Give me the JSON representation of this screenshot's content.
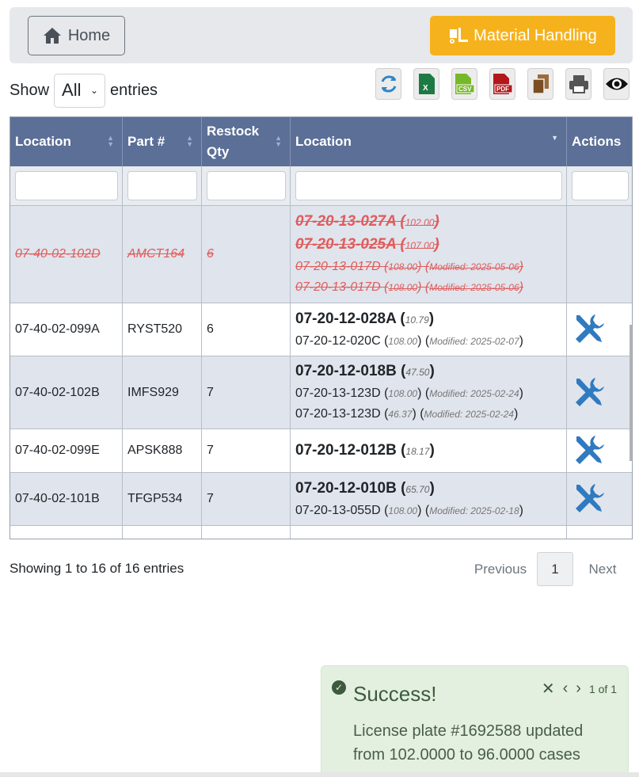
{
  "header": {
    "home_label": "Home",
    "material_label": "Material Handling",
    "accent_color": "#f6b21c"
  },
  "length_menu": {
    "show_label": "Show",
    "selected": "All",
    "entries_label": "entries"
  },
  "toolbar": {
    "buttons": [
      "refresh-icon",
      "excel-icon",
      "csv-icon",
      "pdf-icon",
      "copy-icon",
      "print-icon",
      "eye-icon"
    ],
    "excel_text": "X",
    "csv_text": "CSV",
    "pdf_text": "PDF"
  },
  "table": {
    "columns": [
      "Location",
      "Part #",
      "Restock Qty",
      "Location",
      "Actions"
    ],
    "rows": [
      {
        "location": "07-40-02-102D",
        "part": "AMCT164",
        "restock": "6",
        "main_locs": [
          {
            "loc": "07-20-13-027A",
            "qty": "102.00"
          },
          {
            "loc": "07-20-13-025A",
            "qty": "107.00"
          }
        ],
        "sub_locs": [
          {
            "loc": "07-20-13-017D",
            "qty": "108.00",
            "mod": "Modified: 2025-05-06"
          },
          {
            "loc": "07-20-13-017D",
            "qty": "108.00",
            "mod": "Modified: 2025-05-06"
          }
        ]
      },
      {
        "location": "07-40-02-099A",
        "part": "RYST520",
        "restock": "6",
        "main_loc": "07-20-12-028A",
        "main_qty": "10.79",
        "sub_locs": [
          {
            "loc": "07-20-12-020C",
            "qty": "108.00",
            "mod": "Modified: 2025-02-07"
          }
        ]
      },
      {
        "location": "07-40-02-102B",
        "part": "IMFS929",
        "restock": "7",
        "main_loc": "07-20-12-018B",
        "main_qty": "47.50",
        "sub_locs": [
          {
            "loc": "07-20-13-123D",
            "qty": "108.00",
            "mod": "Modified: 2025-02-24"
          },
          {
            "loc": "07-20-13-123D",
            "qty": "46.37",
            "mod": "Modified: 2025-02-24"
          }
        ]
      },
      {
        "location": "07-40-02-099E",
        "part": "APSK888",
        "restock": "7",
        "main_loc": "07-20-12-012B",
        "main_qty": "18.17",
        "sub_locs": []
      },
      {
        "location": "07-40-02-101B",
        "part": "TFGP534",
        "restock": "7",
        "main_loc": "07-20-12-010B",
        "main_qty": "65.70",
        "sub_locs": [
          {
            "loc": "07-20-13-055D",
            "qty": "108.00",
            "mod": "Modified: 2025-02-18"
          }
        ]
      }
    ]
  },
  "info_text": "Showing 1 to 16 of 16 entries",
  "pagination": {
    "previous": "Previous",
    "page": "1",
    "next": "Next"
  },
  "toast": {
    "title": "Success!",
    "counter": "1 of 1",
    "message": "License plate #1692588 updated from 102.0000 to 96.0000 cases"
  }
}
